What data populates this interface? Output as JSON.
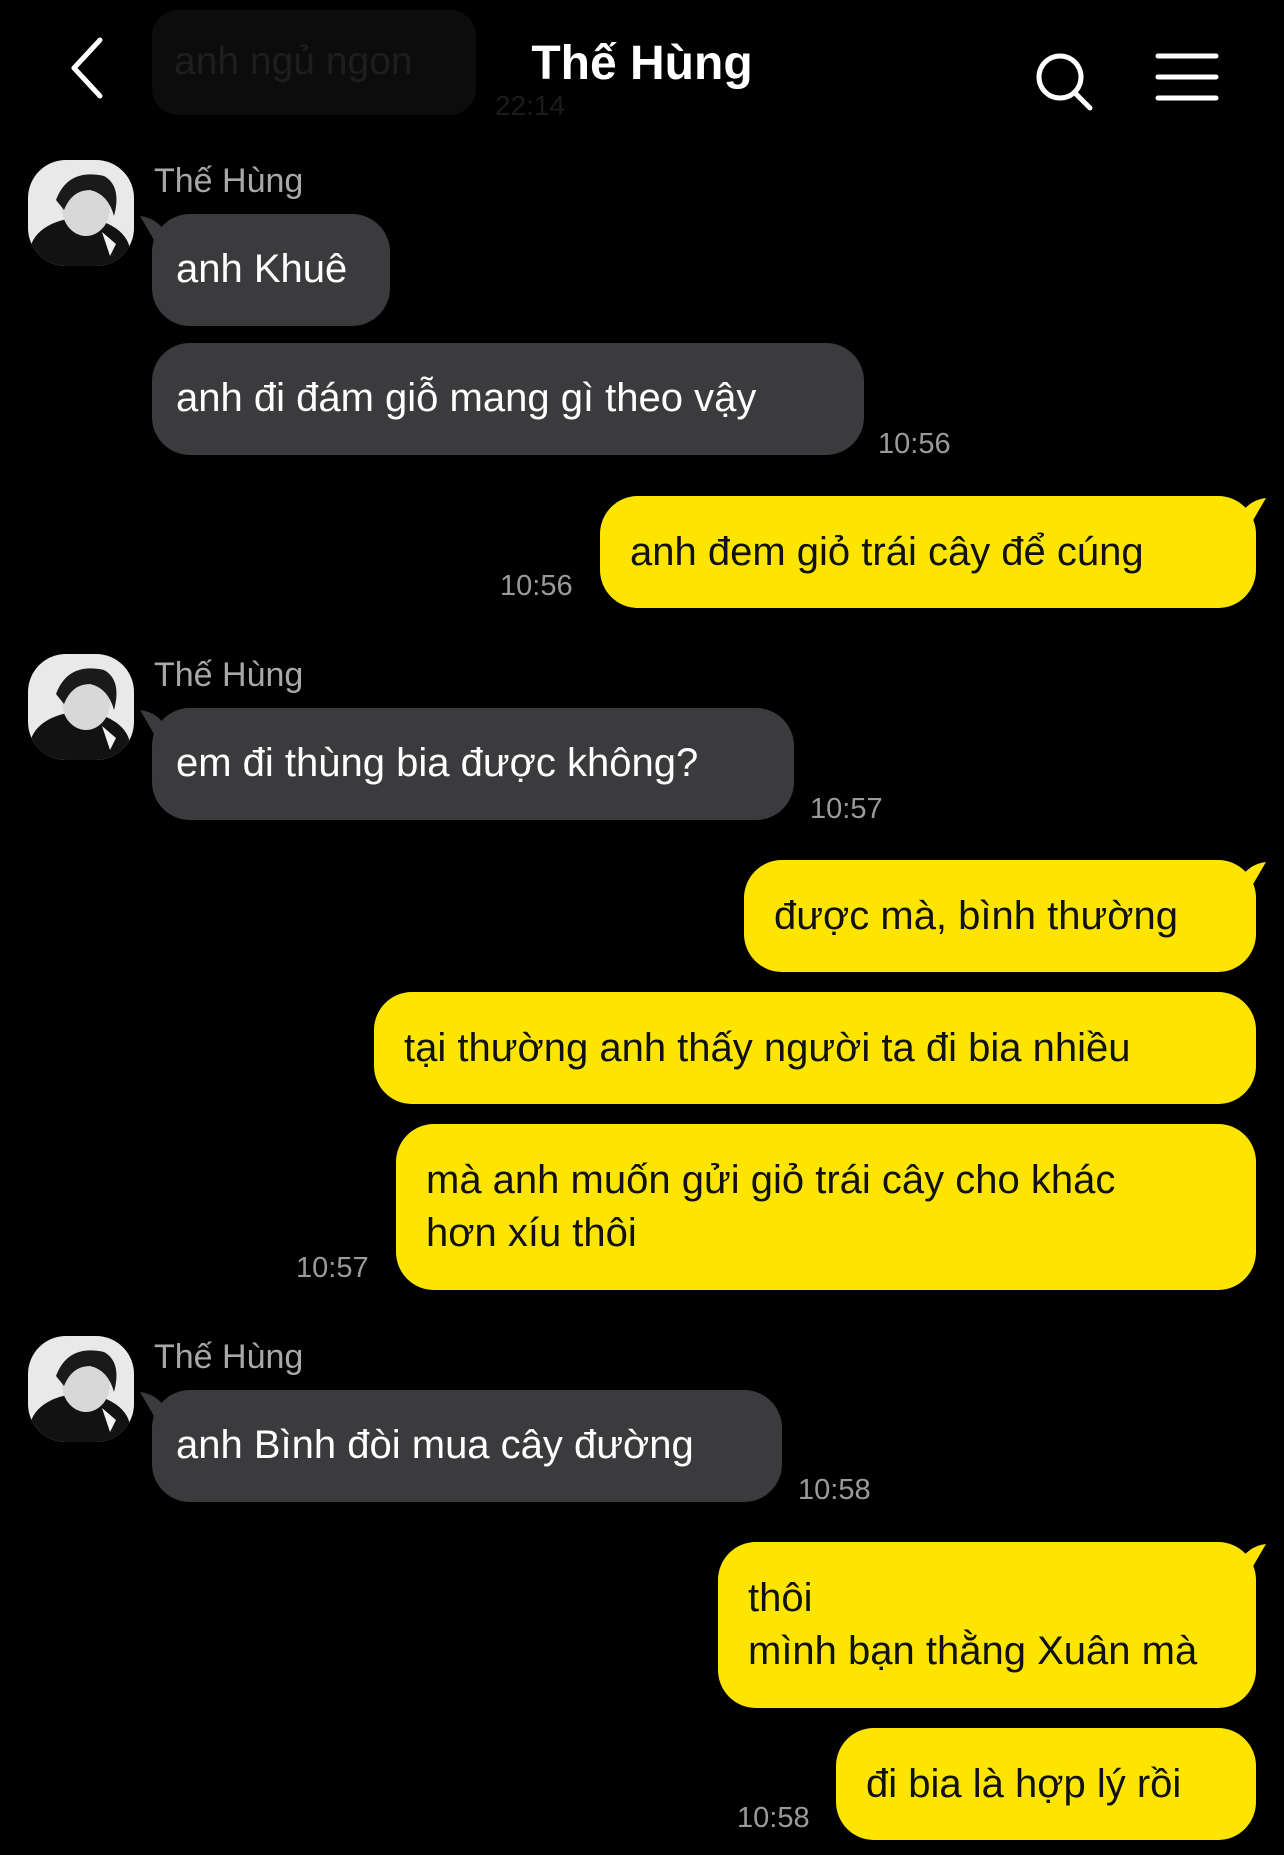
{
  "header": {
    "title": "Thế Hùng",
    "ghost_message": "anh ngủ ngon",
    "ghost_time": "22:14"
  },
  "messages": [
    {
      "sender": "Thế Hùng",
      "lines": [
        "anh Khuê"
      ]
    },
    {
      "lines": [
        "anh đi đám giỗ mang gì theo vậy"
      ],
      "time": "10:56"
    },
    {
      "lines": [
        "anh đem giỏ trái cây để cúng"
      ],
      "time": "10:56"
    },
    {
      "sender": "Thế Hùng",
      "lines": [
        "em đi thùng bia được không?"
      ],
      "time": "10:57"
    },
    {
      "lines": [
        "được mà, bình thường"
      ]
    },
    {
      "lines": [
        "tại thường anh thấy người ta đi bia nhiều"
      ]
    },
    {
      "lines": [
        "mà anh muốn gửi giỏ trái cây cho khác",
        "hơn xíu thôi"
      ],
      "time": "10:57"
    },
    {
      "sender": "Thế Hùng",
      "lines": [
        "anh Bình đòi mua cây đường"
      ],
      "time": "10:58"
    },
    {
      "lines": [
        "thôi",
        "mình bạn thằng Xuân mà"
      ]
    },
    {
      "lines": [
        "đi bia là hợp lý rồi"
      ],
      "time": "10:58"
    }
  ],
  "colors": {
    "background": "#000000",
    "incoming_bubble": "#3b3b3d",
    "outgoing_bubble": "#fee500",
    "timestamp": "#9a9a9a"
  },
  "icons": {
    "back": "chevron-left-icon",
    "search": "search-icon",
    "menu": "hamburger-menu-icon"
  }
}
